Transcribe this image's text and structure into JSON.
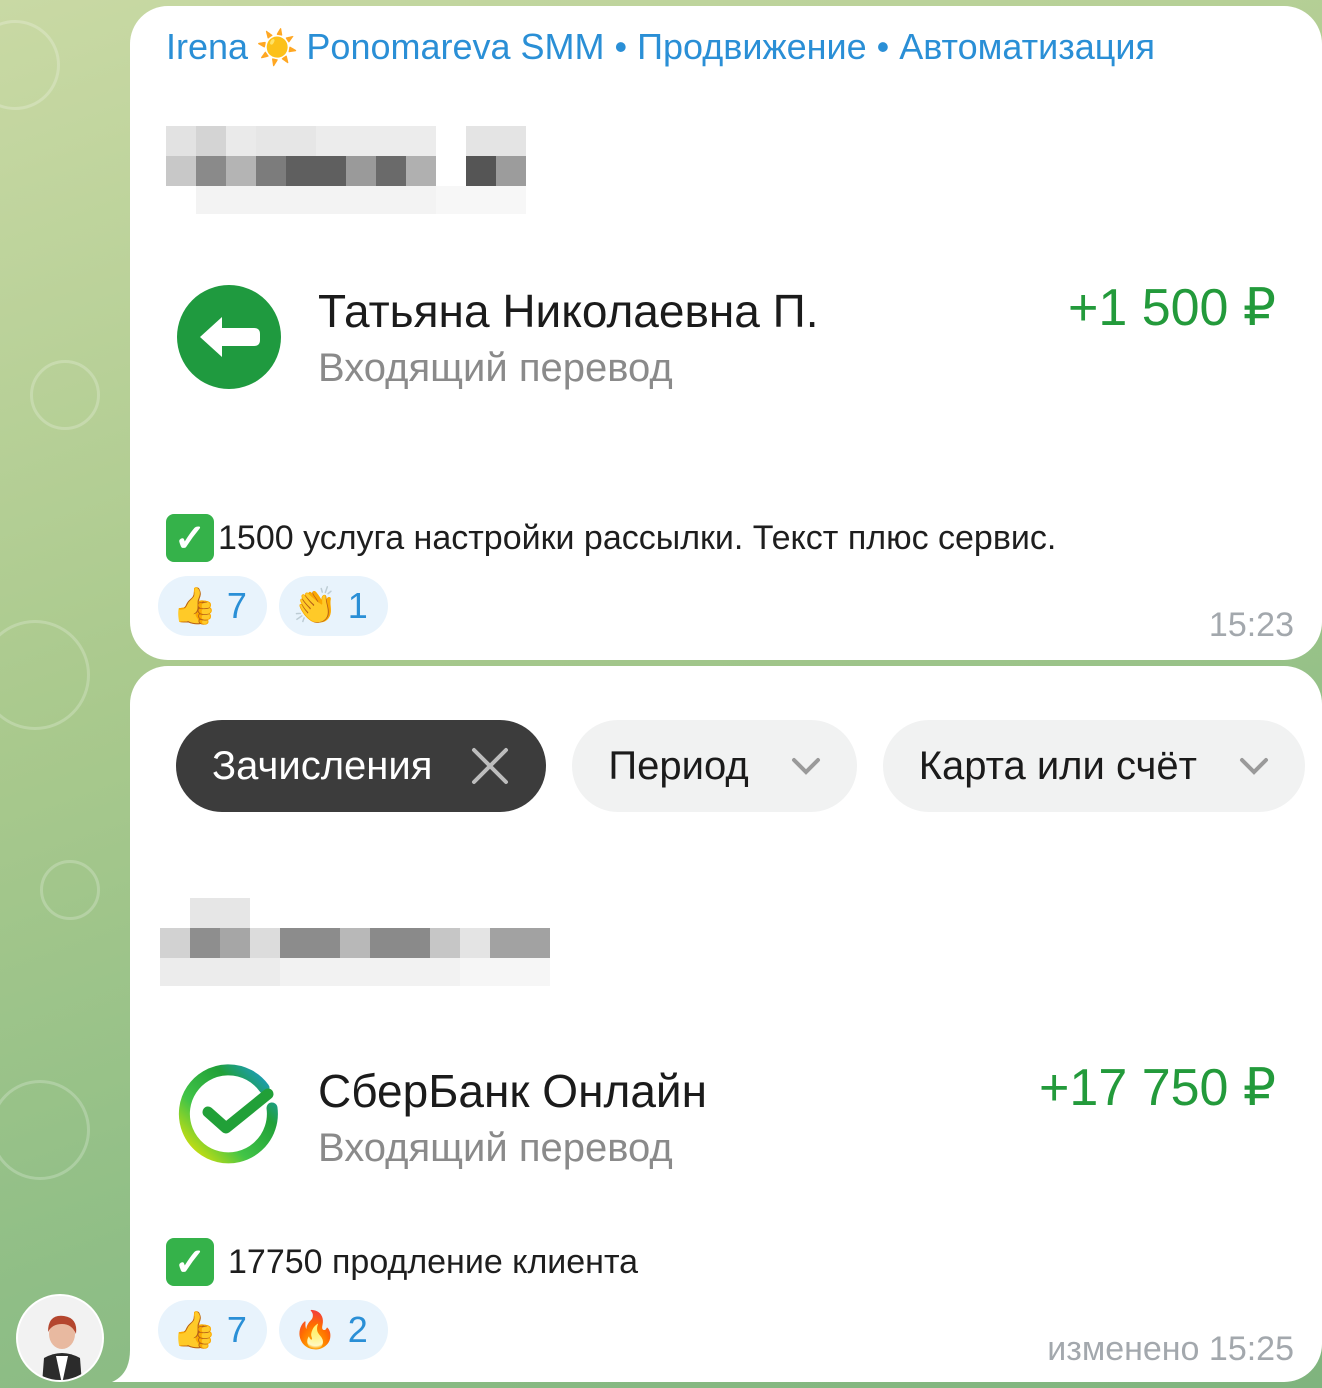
{
  "colors": {
    "author": "#2a8fd6",
    "amount": "#239a3b",
    "reaction_bg": "#e8f3fc",
    "chip_dark": "#3c3c3c",
    "chip_light": "#f1f2f2"
  },
  "messages": [
    {
      "author": {
        "first": "Irena",
        "emoji": "sun-emoji",
        "rest": "Ponomareva SMM • Продвижение • Автоматизация"
      },
      "transaction": {
        "icon": "arrow-left-icon",
        "name": "Татьяна Николаевна П.",
        "subtitle": "Входящий перевод",
        "amount": "+1 500 ₽"
      },
      "caption": "1500 услуга настройки рассылки. Текст плюс сервис.",
      "reactions": [
        {
          "emoji": "👍",
          "icon": "thumbs-up-emoji",
          "count": "7"
        },
        {
          "emoji": "👏",
          "icon": "clapping-hands-emoji",
          "count": "1"
        }
      ],
      "time": "15:23"
    },
    {
      "filters": {
        "active": "Зачисления",
        "period": "Период",
        "account": "Карта или счёт"
      },
      "transaction": {
        "icon": "sberbank-logo",
        "name": "СберБанк Онлайн",
        "subtitle": "Входящий перевод",
        "amount": "+17 750 ₽"
      },
      "caption": "17750 продление клиента",
      "reactions": [
        {
          "emoji": "👍",
          "icon": "thumbs-up-emoji",
          "count": "7"
        },
        {
          "emoji": "🔥",
          "icon": "fire-emoji",
          "count": "2"
        }
      ],
      "time": "изменено 15:25"
    }
  ]
}
